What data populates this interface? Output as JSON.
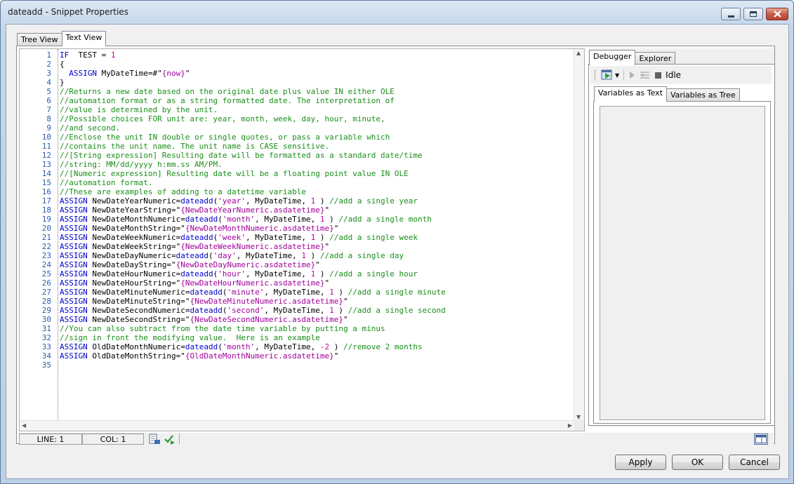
{
  "window": {
    "title": "dateadd - Snippet Properties"
  },
  "tabs": [
    {
      "label": "Tree View",
      "active": false
    },
    {
      "label": "Text View",
      "active": true
    }
  ],
  "editor": {
    "lines": [
      {
        "n": "1",
        "segs": [
          [
            "kw",
            "IF"
          ],
          [
            "",
            "  TEST = "
          ],
          [
            "num",
            "1"
          ]
        ]
      },
      {
        "n": "2",
        "segs": [
          [
            "",
            "{"
          ]
        ]
      },
      {
        "n": "3",
        "segs": [
          [
            "",
            "  "
          ],
          [
            "kw",
            "ASSIGN"
          ],
          [
            "",
            " MyDateTime=#\""
          ],
          [
            "st",
            "{now}"
          ],
          [
            "",
            "\""
          ]
        ]
      },
      {
        "n": "4",
        "segs": [
          [
            "",
            "}"
          ]
        ]
      },
      {
        "n": "5",
        "segs": [
          [
            "cm",
            "//Returns a new date based on the original date plus value IN either OLE"
          ]
        ]
      },
      {
        "n": "6",
        "segs": [
          [
            "cm",
            "//automation format or as a string formatted date. The interpretation of"
          ]
        ]
      },
      {
        "n": "7",
        "segs": [
          [
            "cm",
            "//value is determined by the unit."
          ]
        ]
      },
      {
        "n": "8",
        "segs": [
          [
            "cm",
            "//Possible choices FOR unit are: year, month, week, day, hour, minute,"
          ]
        ]
      },
      {
        "n": "9",
        "segs": [
          [
            "cm",
            "//and second."
          ]
        ]
      },
      {
        "n": "10",
        "segs": [
          [
            "cm",
            "//Enclose the unit IN double or single quotes, or pass a variable which"
          ]
        ]
      },
      {
        "n": "11",
        "segs": [
          [
            "cm",
            "//contains the unit name. The unit name is CASE sensitive."
          ]
        ]
      },
      {
        "n": "12",
        "segs": [
          [
            "cm",
            "//[String expression] Resulting date will be formatted as a standard date/time"
          ]
        ]
      },
      {
        "n": "13",
        "segs": [
          [
            "cm",
            "//string: MM/dd/yyyy h:mm.ss AM/PM."
          ]
        ]
      },
      {
        "n": "14",
        "segs": [
          [
            "cm",
            "//[Numeric expression] Resulting date will be a floating point value IN OLE"
          ]
        ]
      },
      {
        "n": "15",
        "segs": [
          [
            "cm",
            "//automation format."
          ]
        ]
      },
      {
        "n": "16",
        "segs": [
          [
            "cm",
            "//These are examples of adding to a datetime variable"
          ]
        ]
      },
      {
        "n": "17",
        "segs": [
          [
            "kw",
            "ASSIGN"
          ],
          [
            "",
            " NewDateYearNumeric="
          ],
          [
            "fn",
            "dateadd"
          ],
          [
            "",
            "("
          ],
          [
            "st",
            "'year'"
          ],
          [
            "",
            ", MyDateTime, "
          ],
          [
            "num",
            "1"
          ],
          [
            "",
            " ) "
          ],
          [
            "cm",
            "//add a single year"
          ]
        ]
      },
      {
        "n": "18",
        "segs": [
          [
            "kw",
            "ASSIGN"
          ],
          [
            "",
            " NewDateYearString=\""
          ],
          [
            "st",
            "{NewDateYearNumeric.asdatetime}"
          ],
          [
            "",
            "\""
          ]
        ]
      },
      {
        "n": "19",
        "segs": [
          [
            "kw",
            "ASSIGN"
          ],
          [
            "",
            " NewDateMonthNumeric="
          ],
          [
            "fn",
            "dateadd"
          ],
          [
            "",
            "("
          ],
          [
            "st",
            "'month'"
          ],
          [
            "",
            ", MyDateTime, "
          ],
          [
            "num",
            "1"
          ],
          [
            "",
            " ) "
          ],
          [
            "cm",
            "//add a single month"
          ]
        ]
      },
      {
        "n": "20",
        "segs": [
          [
            "kw",
            "ASSIGN"
          ],
          [
            "",
            " NewDateMonthString=\""
          ],
          [
            "st",
            "{NewDateMonthNumeric.asdatetime}"
          ],
          [
            "",
            "\""
          ]
        ]
      },
      {
        "n": "21",
        "segs": [
          [
            "kw",
            "ASSIGN"
          ],
          [
            "",
            " NewDateWeekNumeric="
          ],
          [
            "fn",
            "dateadd"
          ],
          [
            "",
            "("
          ],
          [
            "st",
            "'week'"
          ],
          [
            "",
            ", MyDateTime, "
          ],
          [
            "num",
            "1"
          ],
          [
            "",
            " ) "
          ],
          [
            "cm",
            "//add a single week"
          ]
        ]
      },
      {
        "n": "22",
        "segs": [
          [
            "kw",
            "ASSIGN"
          ],
          [
            "",
            " NewDateWeekString=\""
          ],
          [
            "st",
            "{NewDateWeekNumeric.asdatetime}"
          ],
          [
            "",
            "\""
          ]
        ]
      },
      {
        "n": "23",
        "segs": [
          [
            "kw",
            "ASSIGN"
          ],
          [
            "",
            " NewDateDayNumeric="
          ],
          [
            "fn",
            "dateadd"
          ],
          [
            "",
            "("
          ],
          [
            "st",
            "'day'"
          ],
          [
            "",
            ", MyDateTime, "
          ],
          [
            "num",
            "1"
          ],
          [
            "",
            " ) "
          ],
          [
            "cm",
            "//add a single day"
          ]
        ]
      },
      {
        "n": "24",
        "segs": [
          [
            "kw",
            "ASSIGN"
          ],
          [
            "",
            " NewDateDayString=\""
          ],
          [
            "st",
            "{NewDateDayNumeric.asdatetime}"
          ],
          [
            "",
            "\""
          ]
        ]
      },
      {
        "n": "25",
        "segs": [
          [
            "kw",
            "ASSIGN"
          ],
          [
            "",
            " NewDateHourNumeric="
          ],
          [
            "fn",
            "dateadd"
          ],
          [
            "",
            "("
          ],
          [
            "st",
            "'hour'"
          ],
          [
            "",
            ", MyDateTime, "
          ],
          [
            "num",
            "1"
          ],
          [
            "",
            " ) "
          ],
          [
            "cm",
            "//add a single hour"
          ]
        ]
      },
      {
        "n": "26",
        "segs": [
          [
            "kw",
            "ASSIGN"
          ],
          [
            "",
            " NewDateHourString=\""
          ],
          [
            "st",
            "{NewDateHourNumeric.asdatetime}"
          ],
          [
            "",
            "\""
          ]
        ]
      },
      {
        "n": "27",
        "segs": [
          [
            "kw",
            "ASSIGN"
          ],
          [
            "",
            " NewDateMinuteNumeric="
          ],
          [
            "fn",
            "dateadd"
          ],
          [
            "",
            "("
          ],
          [
            "st",
            "'minute'"
          ],
          [
            "",
            ", MyDateTime, "
          ],
          [
            "num",
            "1"
          ],
          [
            "",
            " ) "
          ],
          [
            "cm",
            "//add a single minute"
          ]
        ]
      },
      {
        "n": "28",
        "segs": [
          [
            "kw",
            "ASSIGN"
          ],
          [
            "",
            " NewDateMinuteString=\""
          ],
          [
            "st",
            "{NewDateMinuteNumeric.asdatetime}"
          ],
          [
            "",
            "\""
          ]
        ]
      },
      {
        "n": "29",
        "segs": [
          [
            "kw",
            "ASSIGN"
          ],
          [
            "",
            " NewDateSecondNumeric="
          ],
          [
            "fn",
            "dateadd"
          ],
          [
            "",
            "("
          ],
          [
            "st",
            "'second'"
          ],
          [
            "",
            ", MyDateTime, "
          ],
          [
            "num",
            "1"
          ],
          [
            "",
            " ) "
          ],
          [
            "cm",
            "//add a single second"
          ]
        ]
      },
      {
        "n": "30",
        "segs": [
          [
            "kw",
            "ASSIGN"
          ],
          [
            "",
            " NewDateSecondString=\""
          ],
          [
            "st",
            "{NewDateSecondNumeric.asdatetime}"
          ],
          [
            "",
            "\""
          ]
        ]
      },
      {
        "n": "31",
        "segs": [
          [
            "cm",
            "//You can also subtract from the date time variable by putting a minus"
          ]
        ]
      },
      {
        "n": "32",
        "segs": [
          [
            "cm",
            "//sign in front the modifying value.  Here is an example"
          ]
        ]
      },
      {
        "n": "33",
        "segs": [
          [
            "kw",
            "ASSIGN"
          ],
          [
            "",
            " OldDateMonthNumeric="
          ],
          [
            "fn",
            "dateadd"
          ],
          [
            "",
            "("
          ],
          [
            "st",
            "'month'"
          ],
          [
            "",
            ", MyDateTime, "
          ],
          [
            "num",
            "-2"
          ],
          [
            "",
            " ) "
          ],
          [
            "cm",
            "//remove 2 months"
          ]
        ]
      },
      {
        "n": "34",
        "segs": [
          [
            "kw",
            "ASSIGN"
          ],
          [
            "",
            " OldDateMonthString=\""
          ],
          [
            "st",
            "{OldDateMonthNumeric.asdatetime}"
          ],
          [
            "",
            "\""
          ]
        ]
      },
      {
        "n": "35",
        "segs": []
      }
    ]
  },
  "status": {
    "line": "LINE: 1",
    "col": "COL: 1"
  },
  "debugger": {
    "tabs": [
      {
        "label": "Debugger",
        "active": true
      },
      {
        "label": "Explorer",
        "active": false
      }
    ],
    "state": "Idle",
    "var_tabs": [
      {
        "label": "Variables as Text",
        "active": true
      },
      {
        "label": "Variables as Tree",
        "active": false
      }
    ]
  },
  "buttons": {
    "apply": "Apply",
    "ok": "OK",
    "cancel": "Cancel"
  }
}
